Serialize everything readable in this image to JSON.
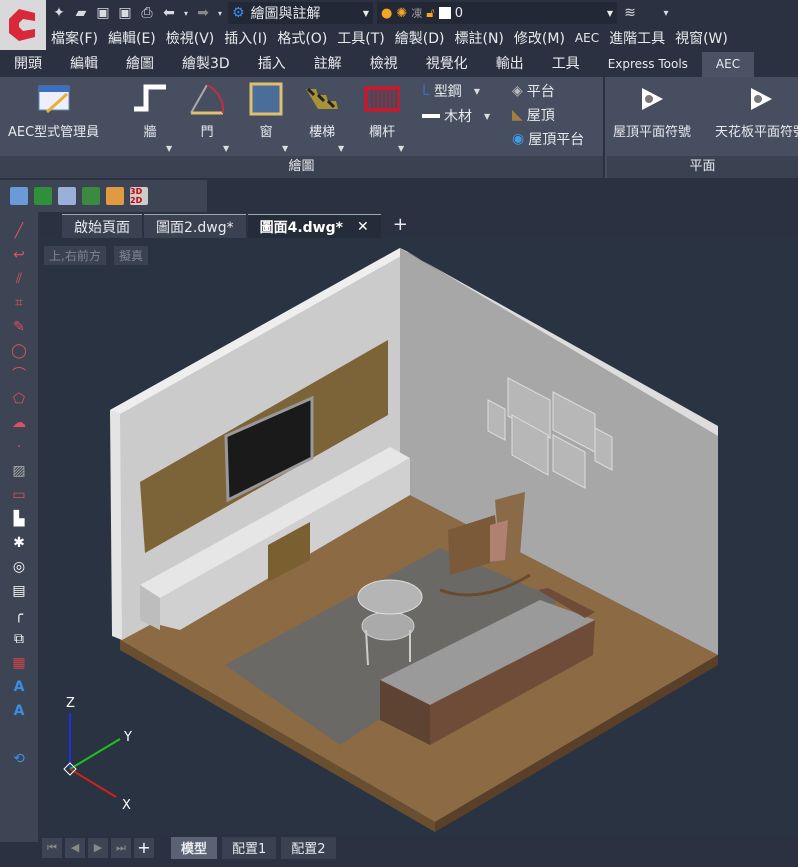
{
  "app": {
    "logo": "C"
  },
  "quick_access": {
    "workspace": "繪圖與註解",
    "layer_value": "0",
    "icons": [
      "new-icon",
      "open-icon",
      "save-icon",
      "save-as-icon",
      "print-icon",
      "undo-icon",
      "redo-icon"
    ]
  },
  "menu": [
    "檔案(F)",
    "編輯(E)",
    "檢視(V)",
    "插入(I)",
    "格式(O)",
    "工具(T)",
    "繪製(D)",
    "標註(N)",
    "修改(M)",
    "AEC",
    "進階工具",
    "視窗(W)"
  ],
  "ribbon_tabs": [
    "開頭",
    "編輯",
    "繪圖",
    "繪製3D",
    "插入",
    "註解",
    "檢視",
    "視覺化",
    "輸出",
    "工具",
    "Express Tools",
    "AEC"
  ],
  "ribbon_active_tab": "AEC",
  "ribbon": {
    "draw_panel": {
      "title": "繪圖",
      "tools": [
        "AEC型式管理員",
        "牆",
        "門",
        "窗",
        "樓梯",
        "欄杆"
      ],
      "small_tools": [
        "型鋼",
        "木材",
        "平台",
        "屋頂",
        "屋頂平台"
      ]
    },
    "plan_panel": {
      "title": "平面",
      "tools": [
        "屋頂平面符號",
        "天花板平面符號"
      ]
    }
  },
  "file_tabs": [
    {
      "label": "啟始頁面"
    },
    {
      "label": "圖面2.dwg*"
    },
    {
      "label": "圖面4.dwg*",
      "active": true,
      "close": "✕"
    }
  ],
  "add_tab": "+",
  "viewport": {
    "view": "上,右前方",
    "style": "擬真",
    "axes": {
      "x": "X",
      "y": "Y",
      "z": "Z"
    }
  },
  "layout_tabs": [
    "模型",
    "配置1",
    "配置2"
  ],
  "layout_active": "模型",
  "colors": {
    "bg": "#2b3140",
    "viewport": "#2a3342",
    "ribbon": "#464e5f",
    "accent_red": "#d8283a"
  }
}
